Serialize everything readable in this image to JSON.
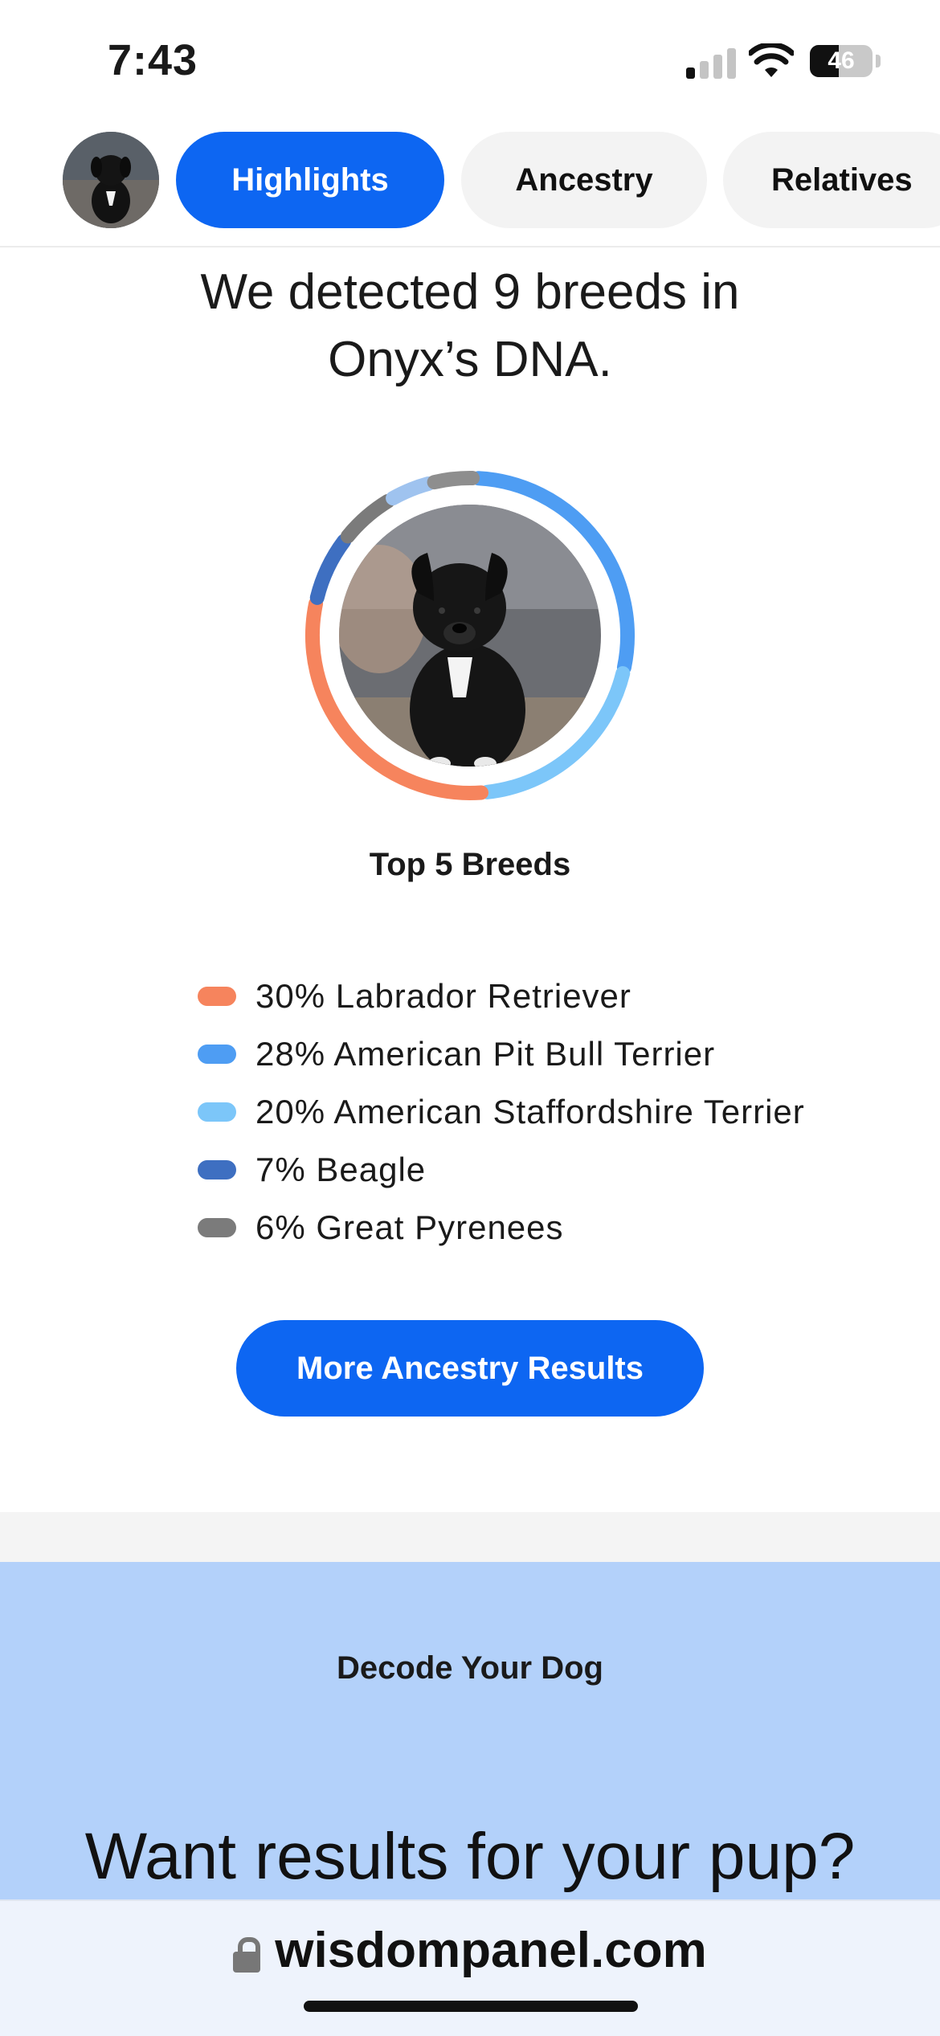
{
  "status_bar": {
    "time": "7:43",
    "battery": "46",
    "signal_bars_on": 1
  },
  "tabs": {
    "items": [
      {
        "label": "Highlights",
        "active": true
      },
      {
        "label": "Ancestry",
        "active": false
      },
      {
        "label": "Relatives",
        "active": false
      }
    ]
  },
  "headline": {
    "line1": "We detected 9 breeds in",
    "line2": "Onyx’s DNA."
  },
  "top5_title": "Top 5 Breeds",
  "breeds": [
    {
      "text": "30% Labrador Retriever",
      "percent": 30,
      "color": "#f6845d"
    },
    {
      "text": "28% American Pit Bull Terrier",
      "percent": 28,
      "color": "#4e9df3"
    },
    {
      "text": "20% American Staffordshire Terrier",
      "percent": 20,
      "color": "#7cc6f9"
    },
    {
      "text": "7% Beagle",
      "percent": 7,
      "color": "#3e6fc1"
    },
    {
      "text": "6% Great Pyrenees",
      "percent": 6,
      "color": "#7b7b7b"
    }
  ],
  "more_button": "More Ancestry Results",
  "promo": {
    "eyebrow": "Decode Your Dog",
    "title": "Want results for your pup?"
  },
  "browser": {
    "url": "wisdompanel.com"
  }
}
